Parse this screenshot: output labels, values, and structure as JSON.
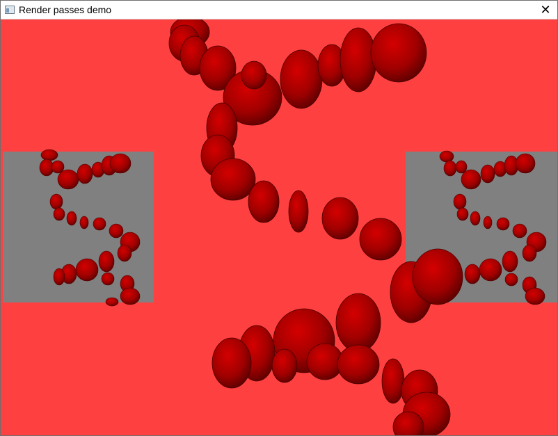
{
  "window": {
    "title": "Render passes demo",
    "close_glyph": "✕",
    "icon": "app-window-icon"
  },
  "scene": {
    "background_color": "#ff4040",
    "object_color": "#b80000",
    "inset_background_color": "#808080",
    "insets": [
      "left-render-pass-view",
      "right-render-pass-view"
    ]
  }
}
